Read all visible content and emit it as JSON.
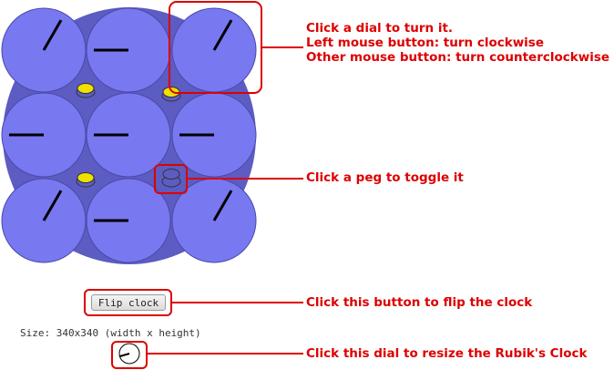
{
  "clock": {
    "face_color": "#5c5cc2",
    "dial_color": "#7878f0",
    "hand_color": "#000000",
    "peg_up_color": "#f0e000",
    "peg_down_color": "#5c5cc2",
    "highlight_color": "#dd0000",
    "dial_hours": [
      1,
      9,
      1,
      9,
      9,
      9,
      1,
      9,
      1
    ],
    "pegs": [
      "up",
      "up",
      "up",
      "down"
    ]
  },
  "controls": {
    "flip_label": "Flip clock",
    "size_text": "Size: 340x340 (width x height)"
  },
  "annotations": {
    "dial_lines": [
      "Click a dial to turn it.",
      "Left mouse button: turn clockwise",
      "Other mouse button: turn counterclockwise"
    ],
    "peg": "Click a peg to toggle it",
    "flip": "Click this button to flip the clock",
    "resize": "Click this dial to resize the Rubik's Clock"
  }
}
